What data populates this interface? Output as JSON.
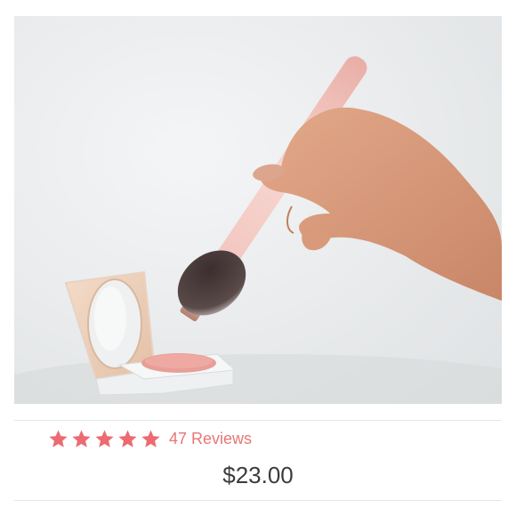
{
  "product": {
    "image_alt": "",
    "rating": 5,
    "rating_max": 5,
    "reviews_label": "47 Reviews",
    "price": "$23.00",
    "star_color": "#ec6b72",
    "link_color": "#e87676"
  }
}
